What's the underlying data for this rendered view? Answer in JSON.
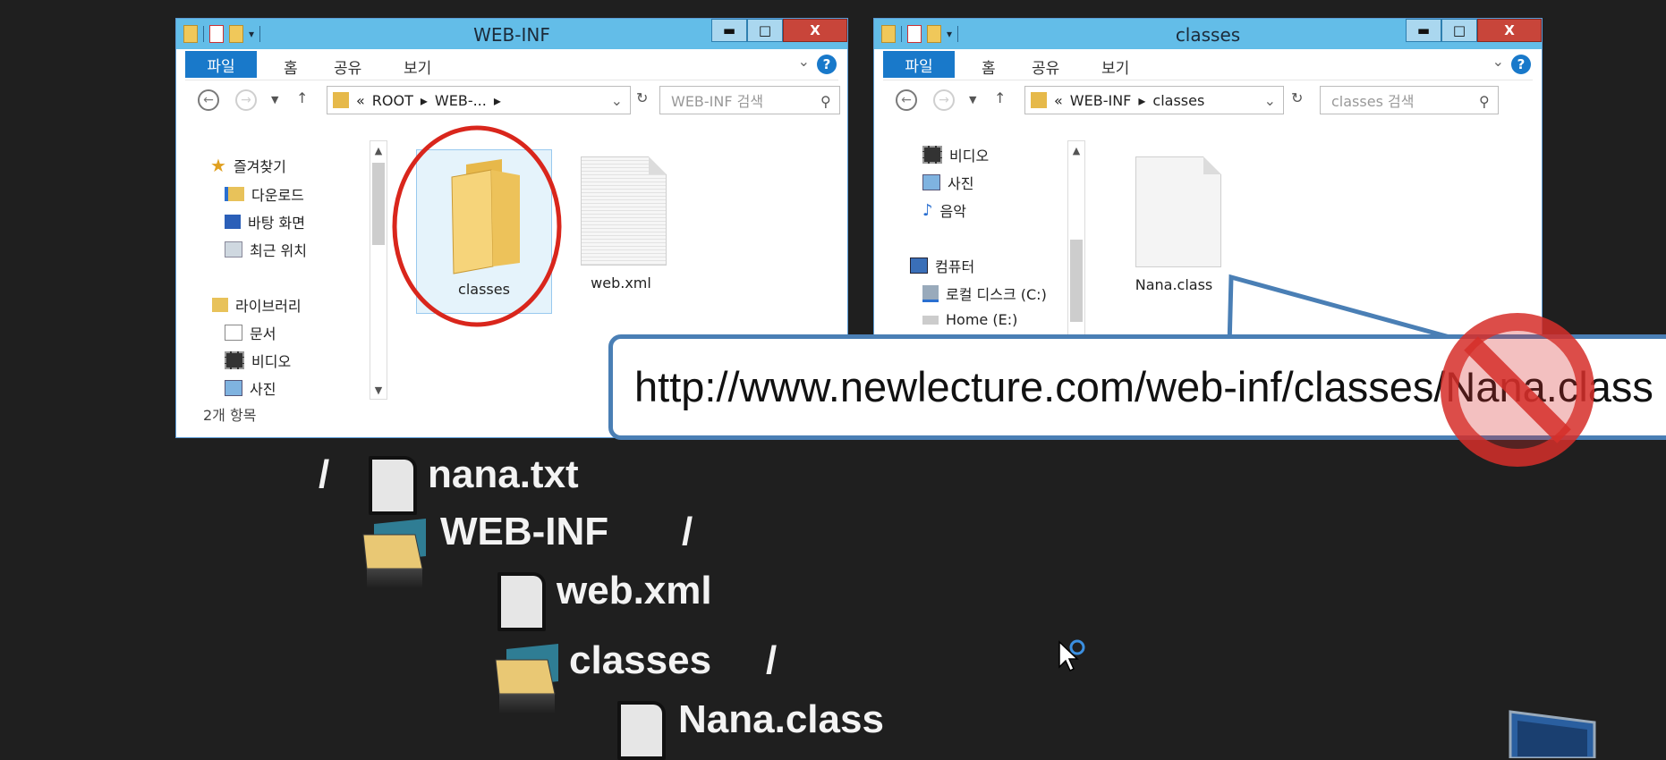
{
  "left_window": {
    "title": "WEB-INF",
    "ribbon_tabs": [
      "파일",
      "홈",
      "공유",
      "보기"
    ],
    "path": [
      "ROOT",
      "WEB-..."
    ],
    "path_prefix": "«",
    "search_placeholder": "WEB-INF 검색",
    "nav_items": [
      "즐겨찾기",
      "다운로드",
      "바탕 화면",
      "최근 위치",
      "라이브러리",
      "문서",
      "비디오",
      "사진"
    ],
    "files": [
      "classes",
      "web.xml"
    ],
    "status": "2개 항목",
    "highlight_color": "#d9261c"
  },
  "right_window": {
    "title": "classes",
    "ribbon_tabs": [
      "파일",
      "홈",
      "공유",
      "보기"
    ],
    "path": [
      "WEB-INF",
      "classes"
    ],
    "path_prefix": "«",
    "search_placeholder": "classes 검색",
    "nav_items": [
      "비디오",
      "사진",
      "음악",
      "컴퓨터",
      "로컬 디스크 (C:)",
      "Home (E:)"
    ],
    "files": [
      "Nana.class"
    ]
  },
  "window_controls": {
    "minimize": "▬",
    "maximize": "□",
    "close": "X"
  },
  "callout": {
    "url": "http://www.newlecture.com/web-inf/classes/Nana.class",
    "forbidden_icon": "no-entry-icon",
    "forbidden_color": "#d62f2a"
  },
  "tree": {
    "root_slash": "/",
    "root_file": "nana.txt",
    "webinf": "WEB-INF",
    "webinf_slash": "/",
    "webxml": "web.xml",
    "classes": "classes",
    "classes_slash": "/",
    "nana_class": "Nana.class"
  },
  "colors": {
    "titlebar": "#63bde8",
    "accent": "#1979ca",
    "background": "#1f1f1f"
  }
}
